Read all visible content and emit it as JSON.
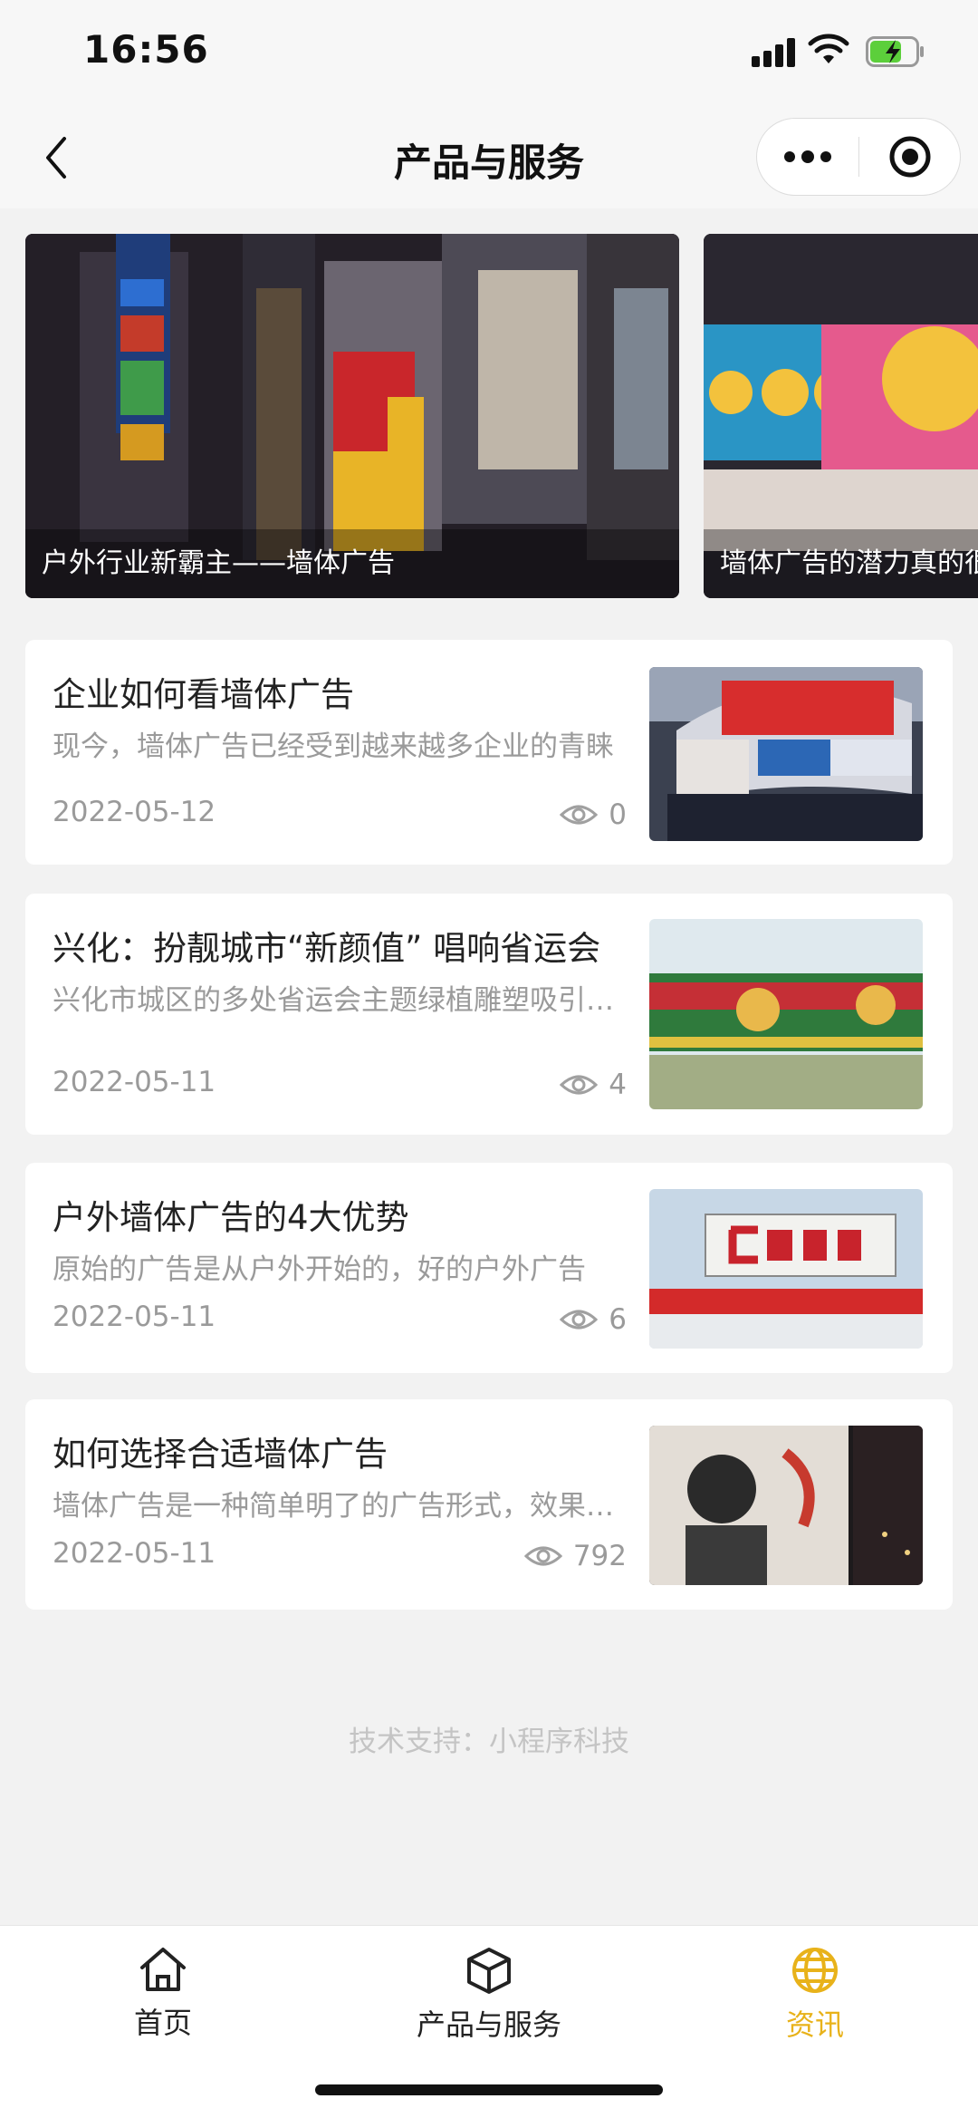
{
  "status_bar": {
    "time": "16:56"
  },
  "nav": {
    "title": "产品与服务"
  },
  "banner": {
    "slides": [
      {
        "caption": "户外行业新霸主——墙体广告"
      },
      {
        "caption": "墙体广告的潜力真的很大"
      }
    ]
  },
  "articles": [
    {
      "title": "企业如何看墙体广告",
      "summary": "现今，墙体广告已经受到越来越多企业的青睐",
      "date": "2022-05-12",
      "views": "0"
    },
    {
      "title": "兴化：扮靓城市“新颜值” 唱响省运会",
      "summary": "兴化市城区的多处省运会主题绿植雕塑吸引市民",
      "date": "2022-05-11",
      "views": "4"
    },
    {
      "title": "户外墙体广告的4大优势",
      "summary": "原始的广告是从户外开始的，好的户外广告",
      "date": "2022-05-11",
      "views": "6"
    },
    {
      "title": "如何选择合适墙体广告",
      "summary": "墙体广告是一种简单明了的广告形式，效果显著",
      "date": "2022-05-11",
      "views": "792"
    }
  ],
  "footer": {
    "credit": "技术支持：小程序科技"
  },
  "tabbar": {
    "items": [
      {
        "label": "首页",
        "icon": "home-icon"
      },
      {
        "label": "产品与服务",
        "icon": "box-icon"
      },
      {
        "label": "资讯",
        "icon": "globe-icon"
      }
    ],
    "active_index": 2
  },
  "colors": {
    "accent": "#e8b21a",
    "background": "#f2f2f2",
    "muted_text": "#9a9a9a"
  }
}
